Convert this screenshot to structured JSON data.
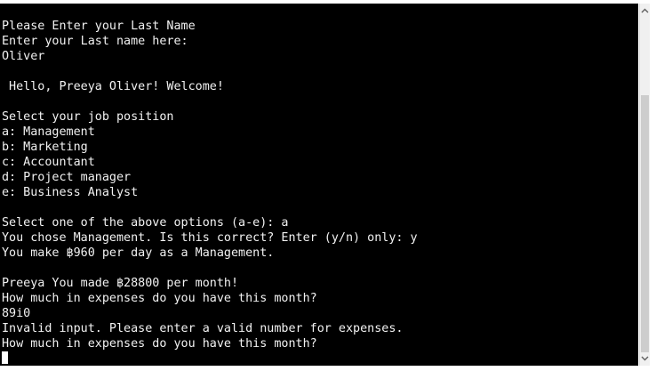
{
  "terminal": {
    "lines": [
      "Please Enter your Last Name",
      "Enter your Last name here:",
      "Oliver",
      "",
      " Hello, Preeya Oliver! Welcome!",
      "",
      "Select your job position",
      "a: Management",
      "b: Marketing",
      "c: Accountant",
      "d: Project manager",
      "e: Business Analyst",
      "",
      "Select one of the above options (a-e): a",
      "You chose Management. Is this correct? Enter (y/n) only: y",
      "You make ฿960 per day as a Management.",
      "",
      "Preeya You made ฿28800 per month!",
      "How much in expenses do you have this month?",
      "89i0",
      "Invalid input. Please enter a valid number for expenses.",
      "How much in expenses do you have this month?"
    ]
  },
  "scrollbar": {
    "up_icon": "chevron-up-icon",
    "down_icon": "chevron-down-icon"
  },
  "colors": {
    "terminal_background": "#000000",
    "terminal_text": "#f2f2f2",
    "scrollbar_track": "#f0f0f0",
    "scrollbar_thumb": "#cdcdcd"
  }
}
